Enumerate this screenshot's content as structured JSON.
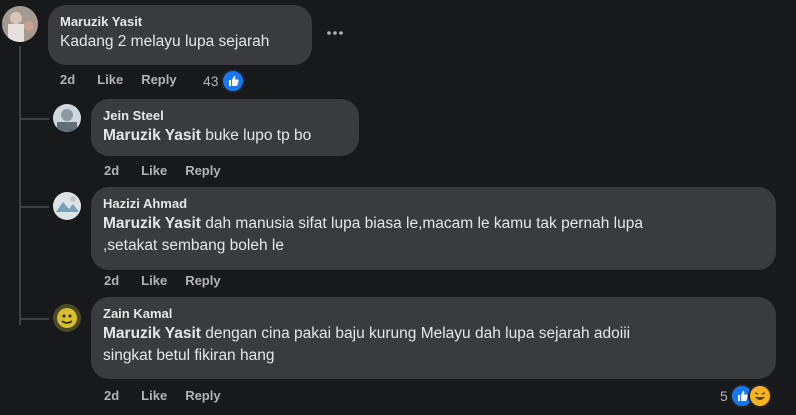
{
  "comments": [
    {
      "author": "Maruzik Yasit",
      "text": "Kadang 2 melayu lupa sejarah",
      "time": "2d",
      "like_label": "Like",
      "reply_label": "Reply",
      "reaction_count": "43",
      "more_icon": "more-dots-icon",
      "avatar_color": "#8a7a78"
    }
  ],
  "replies": [
    {
      "author": "Jein Steel",
      "mention": "Maruzik Yasit",
      "text": "buke lupo tp bo",
      "time": "2d",
      "like_label": "Like",
      "reply_label": "Reply",
      "avatar_color": "#7a8a8f"
    },
    {
      "author": "Hazizi Ahmad",
      "mention": "Maruzik Yasit",
      "text": "dah manusia sifat lupa biasa le,macam le kamu tak pernah lupa",
      "text_line2": ",setakat sembang boleh le",
      "time": "2d",
      "like_label": "Like",
      "reply_label": "Reply",
      "avatar_color": "#9aa3a8"
    },
    {
      "author": "Zain Kamal",
      "mention": "Maruzik Yasit",
      "text": "dengan cina pakai baju kurung Melayu dah lupa sejarah adoiii",
      "text_line2": "singkat betul fikiran hang",
      "time": "2d",
      "like_label": "Like",
      "reply_label": "Reply",
      "reaction_count": "5",
      "avatar_color": "#c9b23a"
    }
  ],
  "colors": {
    "background": "#18191a",
    "bubble": "#3a3b3c",
    "text": "#e4e6eb",
    "secondary": "#b0b3b8",
    "like_blue": "#1877f2",
    "haha_yellow": "#f7b125"
  }
}
